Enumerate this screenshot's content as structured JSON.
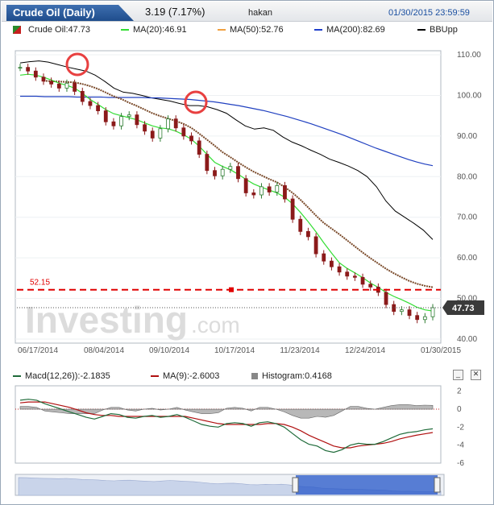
{
  "header": {
    "title": "Crude Oil (Daily)",
    "change": "3.19 (7.17%)",
    "user": "hakan",
    "timestamp": "01/30/2015 23:59:59"
  },
  "legend": [
    {
      "label": "Crude Oil:47.73",
      "color": "#2f8a2f"
    },
    {
      "label": "MA(20):46.91",
      "color": "#33dd33"
    },
    {
      "label": "MA(50):52.76",
      "color": "#f0a040"
    },
    {
      "label": "MA(200):82.69",
      "color": "#1f3fcc"
    },
    {
      "label": "BBUpp",
      "color": "#000000"
    }
  ],
  "watermark": {
    "brand": "Investing",
    "suffix": ".com"
  },
  "colors": {
    "up": "#2e7d32",
    "down": "#8b1a1a",
    "ma20": "#33dd33",
    "ma50": "#7a4a2a",
    "ma200": "#2040c0",
    "bollinger": "#000000",
    "support": "#e00000",
    "circle": "#e84040",
    "macd": "#1f6b3a",
    "signal": "#b01010",
    "histogram": "#666666"
  },
  "chart_data": [
    {
      "type": "line",
      "title": "Crude Oil (Daily)",
      "x_ticks": [
        "06/17/2014",
        "08/04/2014",
        "09/10/2014",
        "10/17/2014",
        "11/23/2014",
        "12/24/2014",
        "01/30/2015"
      ],
      "y_ticks": [
        "110.00",
        "100.00",
        "90.00",
        "80.00",
        "70.00",
        "60.00",
        "50.00",
        "40.00"
      ],
      "ylim": [
        39,
        111
      ],
      "last_price_label": "47.73",
      "support_line": {
        "value": 52.15,
        "label": "52.15"
      },
      "last_price_line": 47.73,
      "series": [
        {
          "name": "Crude Oil",
          "values": [
            106.9,
            106.0,
            104.5,
            103.5,
            102.8,
            101.8,
            103.0,
            101.0,
            98.5,
            97.5,
            96.2,
            93.5,
            92.5,
            94.8,
            95.2,
            92.8,
            91.2,
            89.5,
            91.8,
            94.2,
            92.0,
            90.0,
            88.8,
            85.5,
            81.5,
            80.2,
            81.8,
            82.5,
            79.5,
            76.0,
            75.5,
            77.5,
            76.2,
            77.8,
            74.5,
            69.5,
            66.5,
            65.2,
            61.0,
            59.2,
            57.8,
            56.5,
            55.5,
            55.2,
            53.5,
            52.8,
            51.5,
            48.5,
            46.8,
            47.2,
            45.8,
            44.8,
            45.5,
            47.73
          ]
        },
        {
          "name": "MA(20)",
          "values": [
            105.0,
            105.2,
            105.0,
            104.5,
            103.8,
            103.0,
            102.5,
            101.8,
            100.5,
            99.0,
            97.8,
            96.5,
            95.5,
            95.0,
            94.5,
            94.0,
            93.2,
            92.5,
            92.0,
            91.8,
            91.2,
            90.3,
            89.2,
            87.5,
            85.5,
            83.5,
            82.5,
            81.7,
            80.6,
            79.3,
            78.2,
            77.4,
            76.7,
            76.0,
            74.9,
            73.3,
            71.2,
            68.9,
            66.4,
            63.7,
            61.2,
            58.8,
            57.4,
            56.3,
            55.1,
            53.8,
            52.7,
            51.5,
            50.5,
            49.7,
            48.8,
            47.8,
            47.2,
            46.91
          ]
        },
        {
          "name": "MA(50)",
          "values": [
            null,
            null,
            null,
            103.6,
            103.5,
            103.4,
            103.3,
            103.2,
            102.8,
            102.3,
            101.6,
            100.7,
            99.8,
            99.1,
            98.2,
            97.4,
            96.5,
            95.6,
            94.9,
            94.3,
            93.7,
            93.0,
            92.0,
            90.6,
            89.1,
            87.6,
            86.0,
            84.8,
            83.5,
            82.3,
            81.2,
            80.3,
            79.4,
            78.6,
            77.4,
            76.0,
            74.3,
            72.4,
            70.4,
            68.6,
            67.2,
            65.8,
            64.3,
            62.8,
            61.3,
            59.9,
            58.6,
            57.3,
            56.2,
            55.2,
            54.3,
            53.6,
            53.1,
            52.76
          ]
        },
        {
          "name": "MA(200)",
          "values": [
            99.8,
            99.8,
            99.8,
            99.7,
            99.7,
            99.7,
            99.7,
            99.6,
            99.6,
            99.6,
            99.6,
            99.5,
            99.5,
            99.5,
            99.5,
            99.5,
            99.4,
            99.4,
            99.3,
            99.2,
            99.1,
            99.0,
            98.8,
            98.6,
            98.4,
            98.1,
            97.8,
            97.5,
            97.1,
            96.7,
            96.3,
            95.8,
            95.3,
            94.8,
            94.2,
            93.6,
            93.0,
            92.3,
            91.6,
            90.9,
            90.2,
            89.4,
            88.6,
            87.8,
            87.0,
            86.3,
            85.6,
            84.9,
            84.2,
            83.6,
            83.1,
            82.7
          ]
        },
        {
          "name": "BBUpp",
          "values": [
            108.0,
            108.3,
            108.5,
            108.2,
            107.6,
            107.0,
            106.5,
            106.0,
            105.0,
            103.5,
            101.8,
            100.8,
            100.5,
            100.0,
            99.4,
            99.0,
            98.6,
            98.0,
            97.5,
            97.5,
            97.2,
            96.5,
            95.6,
            94.0,
            92.5,
            91.7,
            92.0,
            91.4,
            89.8,
            88.5,
            87.6,
            86.5,
            85.5,
            84.3,
            83.5,
            82.6,
            81.5,
            80.0,
            77.5,
            74.0,
            71.5,
            70.0,
            68.5,
            66.8,
            64.5
          ]
        }
      ]
    },
    {
      "type": "line",
      "title": "MACD",
      "legend": [
        "Macd(12,26)):-2.1835",
        "MA(9):-2.6003",
        "Histogram:0.4168"
      ],
      "y_ticks": [
        "2",
        "0",
        "-2",
        "-4",
        "-6"
      ],
      "ylim": [
        -6,
        2.6
      ],
      "series": [
        {
          "name": "Macd(12,26)",
          "values": [
            1.0,
            1.1,
            1.0,
            0.6,
            0.3,
            0.0,
            -0.3,
            -0.6,
            -0.9,
            -1.1,
            -0.8,
            -0.5,
            -0.6,
            -0.9,
            -1.0,
            -0.8,
            -0.7,
            -0.9,
            -0.8,
            -0.6,
            -0.9,
            -1.3,
            -1.7,
            -1.9,
            -2.0,
            -1.6,
            -1.5,
            -1.6,
            -1.9,
            -1.5,
            -1.4,
            -1.6,
            -2.0,
            -2.7,
            -3.4,
            -3.9,
            -4.1,
            -4.6,
            -4.8,
            -4.5,
            -4.0,
            -3.8,
            -3.9,
            -3.9,
            -3.6,
            -3.2,
            -2.8,
            -2.6,
            -2.5,
            -2.3,
            -2.18
          ]
        },
        {
          "name": "MA(9)",
          "values": [
            0.7,
            0.8,
            0.8,
            0.8,
            0.6,
            0.4,
            0.2,
            -0.1,
            -0.4,
            -0.6,
            -0.7,
            -0.7,
            -0.8,
            -0.8,
            -0.8,
            -0.8,
            -0.8,
            -0.8,
            -0.8,
            -0.8,
            -0.8,
            -1.0,
            -1.2,
            -1.4,
            -1.6,
            -1.7,
            -1.7,
            -1.7,
            -1.7,
            -1.7,
            -1.6,
            -1.6,
            -1.7,
            -2.0,
            -2.4,
            -2.9,
            -3.3,
            -3.7,
            -4.1,
            -4.3,
            -4.3,
            -4.1,
            -4.0,
            -3.9,
            -3.8,
            -3.6,
            -3.3,
            -3.1,
            -2.9,
            -2.75,
            -2.6
          ]
        },
        {
          "name": "Histogram",
          "values": [
            0.3,
            0.3,
            0.2,
            -0.2,
            -0.3,
            -0.4,
            -0.5,
            -0.5,
            -0.5,
            -0.5,
            -0.1,
            0.2,
            0.2,
            -0.1,
            -0.2,
            0.0,
            0.1,
            -0.1,
            0.0,
            0.2,
            -0.1,
            -0.3,
            -0.5,
            -0.5,
            -0.4,
            0.1,
            0.2,
            0.1,
            -0.2,
            0.2,
            0.2,
            0.0,
            -0.3,
            -0.7,
            -1.0,
            -1.0,
            -0.8,
            -0.9,
            -0.7,
            -0.2,
            0.3,
            0.3,
            0.1,
            0.0,
            0.2,
            0.4,
            0.5,
            0.5,
            0.4,
            0.45,
            0.42
          ]
        }
      ]
    }
  ]
}
